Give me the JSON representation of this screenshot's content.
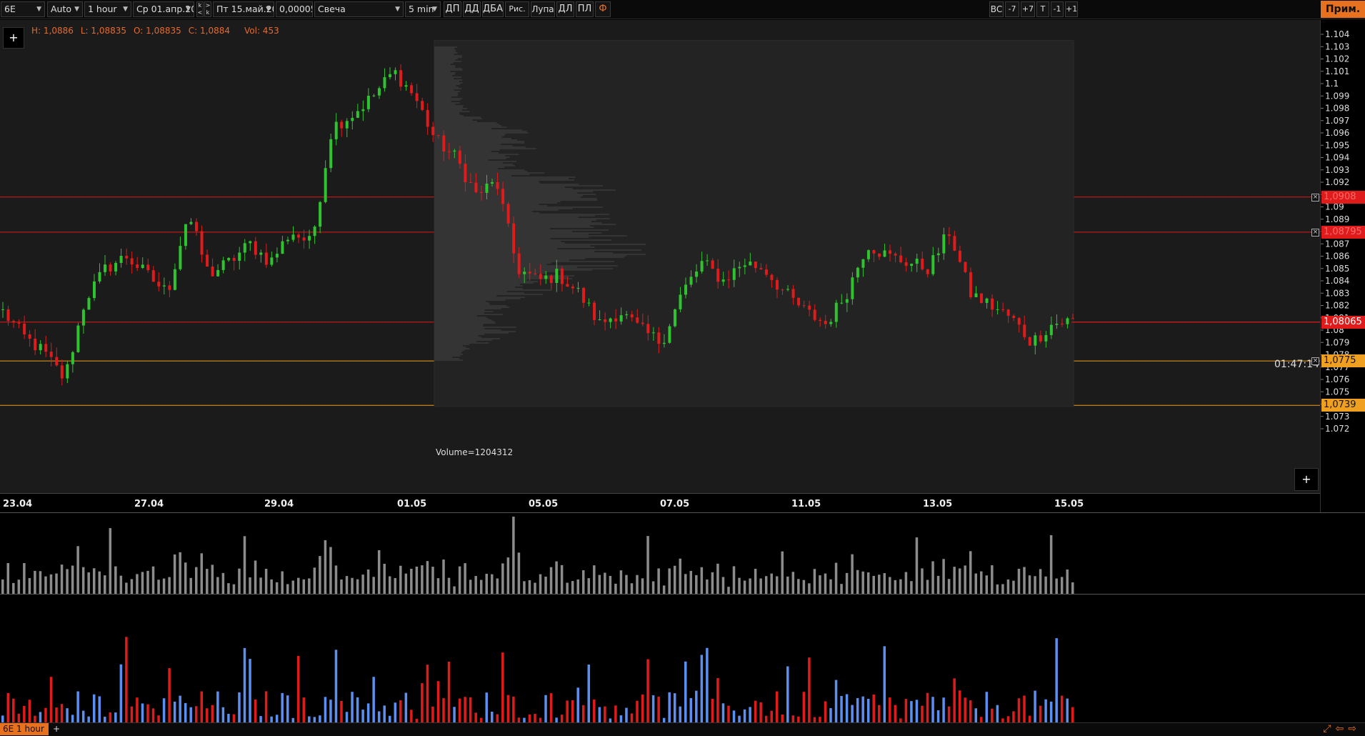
{
  "toolbar": {
    "symbol": "6E",
    "mode": "Auto",
    "timeframe": "1 hour",
    "date_from": "Ср 01.апр.20",
    "date_to": "Пт 15.май.20",
    "tick_size": "0,00005",
    "chart_type": "Свеча",
    "profile_period": "5 min",
    "buttons": [
      "ДП",
      "ДД",
      "ДБА",
      "Рис.",
      "Лупа",
      "ДЛ",
      "ПЛ"
    ],
    "right_buttons": [
      "ВС",
      "-7",
      "+7",
      "T",
      "-1",
      "+1"
    ],
    "apply_label": "Прим."
  },
  "info": {
    "high": "H: 1,0886",
    "low": "L: 1,08835",
    "open": "O: 1,08835",
    "close": "C: 1,0884",
    "volume": "Vol: 453"
  },
  "plus_label": "+",
  "volume_profile_total": "Volume=1204312",
  "timer": "01:47:14",
  "price_levels": [
    {
      "label": "1,0908",
      "price": 1.0908,
      "color": "#e01b1b",
      "text_color": "#ff6a6a",
      "closable": true
    },
    {
      "label": "1,08795",
      "price": 1.08795,
      "color": "#e01b1b",
      "text_color": "#ff6a6a",
      "closable": true
    },
    {
      "label": "1,08065",
      "price": 1.08065,
      "color": "#e01b1b",
      "text_color": "#ffffff",
      "closable": false
    },
    {
      "label": "1,0775",
      "price": 1.0775,
      "color": "#f0a020",
      "text_color": "#111111",
      "closable": true
    },
    {
      "label": "1,0739",
      "price": 1.0739,
      "color": "#f0a020",
      "text_color": "#111111",
      "closable": false
    }
  ],
  "price_axis": [
    "1.104",
    "1.103",
    "1.102",
    "1.101",
    "1.1",
    "1.099",
    "1.098",
    "1.097",
    "1.096",
    "1.095",
    "1.094",
    "1.093",
    "1.092",
    "1.091",
    "1.09",
    "1.089",
    "1.088",
    "1.087",
    "1.086",
    "1.085",
    "1.084",
    "1.083",
    "1.082",
    "1.081",
    "1.08",
    "1.079",
    "1.078",
    "1.077",
    "1.076",
    "1.075",
    "1.074",
    "1.073",
    "1.072"
  ],
  "date_axis": [
    "23.04",
    "27.04",
    "29.04",
    "01.05",
    "05.05",
    "07.05",
    "11.05",
    "13.05",
    "15.05"
  ],
  "status": {
    "tab_label": "6E 1 hour",
    "add_tab": "+",
    "icons": [
      "expand-icon",
      "arrow-left-icon",
      "arrow-right-icon"
    ]
  },
  "colors": {
    "bull": "#2fc42f",
    "bear": "#e01b1b",
    "volume_bar": "#8c8c8c",
    "delta_positive": "#5b8ff0",
    "delta_negative": "#e01b1b",
    "accent": "#e8711f"
  },
  "chart_data": {
    "type": "candlestick",
    "timeframe": "1 hour",
    "price_range": [
      1.0715,
      1.1045
    ],
    "anchors": [
      {
        "date": "22.04",
        "price": 1.0815
      },
      {
        "date": "23.04",
        "price": 1.0795
      },
      {
        "date": "24.04",
        "price": 1.0782
      },
      {
        "date": "24.04",
        "price": 1.076
      },
      {
        "date": "25.04",
        "price": 1.0825
      },
      {
        "date": "26.04",
        "price": 1.085
      },
      {
        "date": "27.04",
        "price": 1.086
      },
      {
        "date": "27.04",
        "price": 1.0845
      },
      {
        "date": "28.04",
        "price": 1.083
      },
      {
        "date": "28.04",
        "price": 1.0895
      },
      {
        "date": "28.04",
        "price": 1.0845
      },
      {
        "date": "29.04",
        "price": 1.0855
      },
      {
        "date": "29.04",
        "price": 1.087
      },
      {
        "date": "30.04",
        "price": 1.0855
      },
      {
        "date": "30.04",
        "price": 1.088
      },
      {
        "date": "30.04",
        "price": 1.087
      },
      {
        "date": "30.04",
        "price": 1.0965
      },
      {
        "date": "01.05",
        "price": 1.0975
      },
      {
        "date": "01.05",
        "price": 1.099
      },
      {
        "date": "01.05",
        "price": 1.101
      },
      {
        "date": "04.05",
        "price": 1.099
      },
      {
        "date": "04.05",
        "price": 1.0955
      },
      {
        "date": "05.05",
        "price": 1.094
      },
      {
        "date": "05.05",
        "price": 1.091
      },
      {
        "date": "05.05",
        "price": 1.092
      },
      {
        "date": "05.05",
        "price": 1.085
      },
      {
        "date": "06.05",
        "price": 1.084
      },
      {
        "date": "06.05",
        "price": 1.0845
      },
      {
        "date": "06.05",
        "price": 1.083
      },
      {
        "date": "06.05",
        "price": 1.0805
      },
      {
        "date": "07.05",
        "price": 1.0815
      },
      {
        "date": "07.05",
        "price": 1.08
      },
      {
        "date": "07.05",
        "price": 1.079
      },
      {
        "date": "08.05",
        "price": 1.083
      },
      {
        "date": "08.05",
        "price": 1.0855
      },
      {
        "date": "08.05",
        "price": 1.084
      },
      {
        "date": "08.05",
        "price": 1.0855
      },
      {
        "date": "11.05",
        "price": 1.085
      },
      {
        "date": "11.05",
        "price": 1.083
      },
      {
        "date": "11.05",
        "price": 1.0815
      },
      {
        "date": "11.05",
        "price": 1.0805
      },
      {
        "date": "12.05",
        "price": 1.083
      },
      {
        "date": "12.05",
        "price": 1.087
      },
      {
        "date": "12.05",
        "price": 1.086
      },
      {
        "date": "12.05",
        "price": 1.0855
      },
      {
        "date": "13.05",
        "price": 1.085
      },
      {
        "date": "13.05",
        "price": 1.088
      },
      {
        "date": "13.05",
        "price": 1.083
      },
      {
        "date": "14.05",
        "price": 1.082
      },
      {
        "date": "14.05",
        "price": 1.081
      },
      {
        "date": "14.05",
        "price": 1.079
      },
      {
        "date": "14.05",
        "price": 1.0805
      },
      {
        "date": "15.05",
        "price": 1.0808
      }
    ]
  }
}
